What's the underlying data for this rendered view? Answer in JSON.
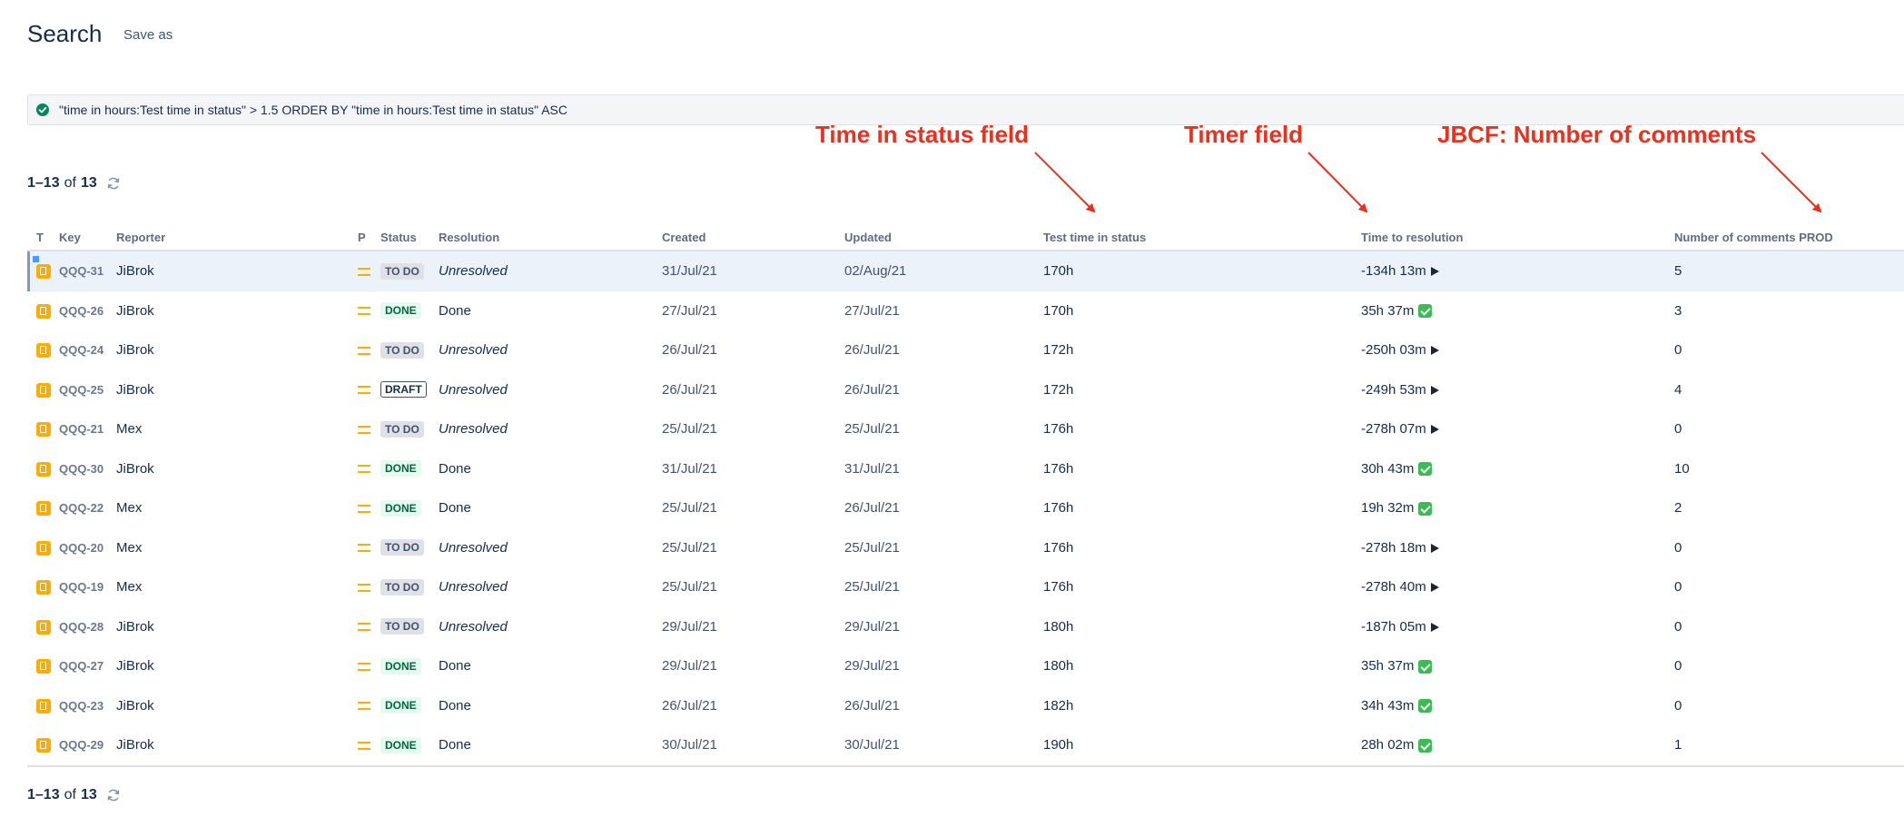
{
  "header": {
    "title": "Search",
    "save_as_label": "Save as"
  },
  "jql": {
    "query": "\"time in hours:Test time in status\" > 1.5 ORDER BY \"time in hours:Test time in status\" ASC"
  },
  "annotations": {
    "time_in_status": "Time in status field",
    "timer": "Timer field",
    "jbcf": "JBCF: Number of comments"
  },
  "pagination": {
    "range": "1–13",
    "of": "of",
    "total": "13"
  },
  "columns": [
    "T",
    "Key",
    "Reporter",
    "P",
    "Status",
    "Resolution",
    "Created",
    "Updated",
    "Test time in status",
    "Time to resolution",
    "Number of comments PROD"
  ],
  "colors": {
    "accent_red": "#ee2f1c",
    "story_orange": "#ffab00",
    "done_green": "#006644"
  },
  "rows": [
    {
      "key": "QQQ-31",
      "reporter": "JiBrok",
      "status": "TO DO",
      "resolution": "Unresolved",
      "created": "31/Jul/21",
      "updated": "02/Aug/21",
      "time_in_status": "170h",
      "time_to_resolution": "-134h 13m",
      "timer_icon": "play-icon",
      "comments": "5"
    },
    {
      "key": "QQQ-26",
      "reporter": "JiBrok",
      "status": "DONE",
      "resolution": "Done",
      "created": "27/Jul/21",
      "updated": "27/Jul/21",
      "time_in_status": "170h",
      "time_to_resolution": "35h 37m",
      "timer_icon": "check-icon",
      "comments": "3"
    },
    {
      "key": "QQQ-24",
      "reporter": "JiBrok",
      "status": "TO DO",
      "resolution": "Unresolved",
      "created": "26/Jul/21",
      "updated": "26/Jul/21",
      "time_in_status": "172h",
      "time_to_resolution": "-250h 03m",
      "timer_icon": "play-icon",
      "comments": "0"
    },
    {
      "key": "QQQ-25",
      "reporter": "JiBrok",
      "status": "DRAFT",
      "resolution": "Unresolved",
      "created": "26/Jul/21",
      "updated": "26/Jul/21",
      "time_in_status": "172h",
      "time_to_resolution": "-249h 53m",
      "timer_icon": "play-icon",
      "comments": "4"
    },
    {
      "key": "QQQ-21",
      "reporter": "Mex",
      "status": "TO DO",
      "resolution": "Unresolved",
      "created": "25/Jul/21",
      "updated": "25/Jul/21",
      "time_in_status": "176h",
      "time_to_resolution": "-278h 07m",
      "timer_icon": "play-icon",
      "comments": "0"
    },
    {
      "key": "QQQ-30",
      "reporter": "JiBrok",
      "status": "DONE",
      "resolution": "Done",
      "created": "31/Jul/21",
      "updated": "31/Jul/21",
      "time_in_status": "176h",
      "time_to_resolution": "30h 43m",
      "timer_icon": "check-icon",
      "comments": "10"
    },
    {
      "key": "QQQ-22",
      "reporter": "Mex",
      "status": "DONE",
      "resolution": "Done",
      "created": "25/Jul/21",
      "updated": "26/Jul/21",
      "time_in_status": "176h",
      "time_to_resolution": "19h 32m",
      "timer_icon": "check-icon",
      "comments": "2"
    },
    {
      "key": "QQQ-20",
      "reporter": "Mex",
      "status": "TO DO",
      "resolution": "Unresolved",
      "created": "25/Jul/21",
      "updated": "25/Jul/21",
      "time_in_status": "176h",
      "time_to_resolution": "-278h 18m",
      "timer_icon": "play-icon",
      "comments": "0"
    },
    {
      "key": "QQQ-19",
      "reporter": "Mex",
      "status": "TO DO",
      "resolution": "Unresolved",
      "created": "25/Jul/21",
      "updated": "25/Jul/21",
      "time_in_status": "176h",
      "time_to_resolution": "-278h 40m",
      "timer_icon": "play-icon",
      "comments": "0"
    },
    {
      "key": "QQQ-28",
      "reporter": "JiBrok",
      "status": "TO DO",
      "resolution": "Unresolved",
      "created": "29/Jul/21",
      "updated": "29/Jul/21",
      "time_in_status": "180h",
      "time_to_resolution": "-187h 05m",
      "timer_icon": "play-icon",
      "comments": "0"
    },
    {
      "key": "QQQ-27",
      "reporter": "JiBrok",
      "status": "DONE",
      "resolution": "Done",
      "created": "29/Jul/21",
      "updated": "29/Jul/21",
      "time_in_status": "180h",
      "time_to_resolution": "35h 37m",
      "timer_icon": "check-icon",
      "comments": "0"
    },
    {
      "key": "QQQ-23",
      "reporter": "JiBrok",
      "status": "DONE",
      "resolution": "Done",
      "created": "26/Jul/21",
      "updated": "26/Jul/21",
      "time_in_status": "182h",
      "time_to_resolution": "34h 43m",
      "timer_icon": "check-icon",
      "comments": "0"
    },
    {
      "key": "QQQ-29",
      "reporter": "JiBrok",
      "status": "DONE",
      "resolution": "Done",
      "created": "30/Jul/21",
      "updated": "30/Jul/21",
      "time_in_status": "190h",
      "time_to_resolution": "28h 02m",
      "timer_icon": "check-icon",
      "comments": "1"
    }
  ]
}
